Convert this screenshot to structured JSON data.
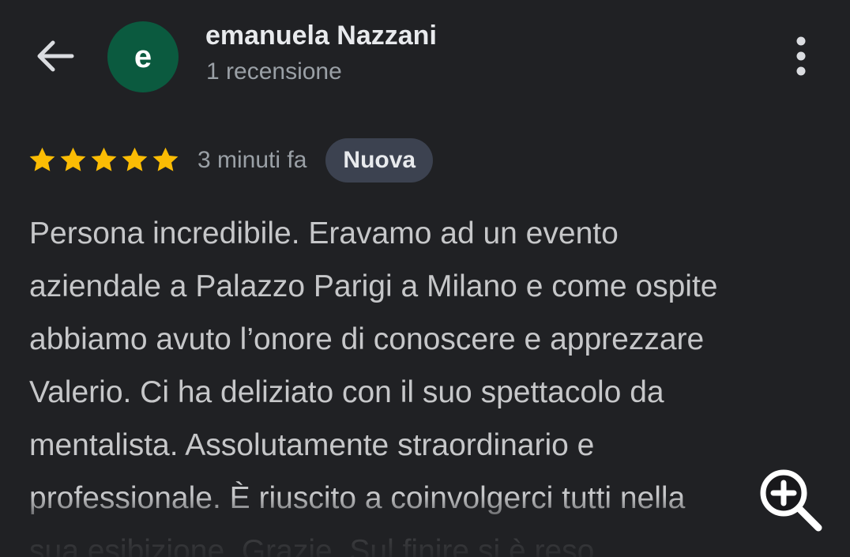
{
  "header": {
    "back_icon": "arrow-back-icon",
    "avatar_letter": "e",
    "reviewer_name": "emanuela Nazzani",
    "review_count": "1 recensione",
    "more_icon": "more-vert-icon"
  },
  "review": {
    "rating": 5,
    "rating_max": 5,
    "star_color": "#fbbc04",
    "time_ago": "3 minuti fa",
    "badge": "Nuova",
    "text": "Persona incredibile. Eravamo ad un evento\naziendale a Palazzo Parigi a Milano e come ospite\nabbiamo avuto l’onore di conoscere e apprezzare\nValerio. Ci ha deliziato con il suo spettacolo da\nmentalista. Assolutamente straordinario e\nprofessionale. È riuscito a coinvolgerci tutti nella\nsua esibizione. Grazie. Sul finire si è reso"
  },
  "overlay": {
    "zoom_icon": "zoom-in-icon"
  },
  "colors": {
    "background": "#202124",
    "avatar_bg": "#0b5a3f",
    "badge_bg": "#3c4250",
    "primary_text": "#e8eaed",
    "secondary_text": "#9aa0a6"
  }
}
